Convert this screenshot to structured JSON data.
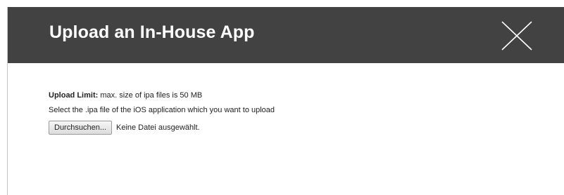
{
  "dialog": {
    "title": "Upload an In-House App",
    "close_icon": "close-icon"
  },
  "content": {
    "upload_limit_label": "Upload Limit:",
    "upload_limit_text": " max. size of ipa files is 50 MB",
    "instruction": "Select the .ipa file of the iOS application which you want to upload",
    "browse_button_label": "Durchsuchen...",
    "file_status": "Keine Datei ausgewählt."
  },
  "colors": {
    "header_background": "#424242",
    "header_text": "#ffffff"
  }
}
